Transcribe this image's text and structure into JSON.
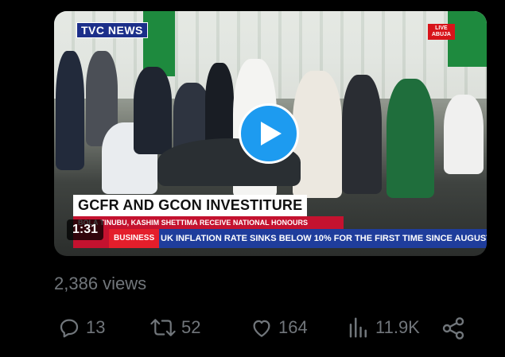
{
  "video": {
    "channel_logo": "TVC NEWS",
    "live_badge": [
      "LIVE",
      "ABUJA"
    ],
    "headline": "GCFR AND GCON INVESTITURE",
    "subheadline": "BOLA TINUBU, KASHIM SHETTIMA RECEIVE NATIONAL HONOURS",
    "ticker_tag": "BUSINESS",
    "ticker_text": "UK INFLATION RATE SINKS BELOW 10% FOR THE FIRST TIME SINCE AUGUST",
    "duration": "1:31",
    "play_icon": "play-icon"
  },
  "stats": {
    "views": "2,386 views"
  },
  "actions": {
    "replies": "13",
    "reposts": "52",
    "likes": "164",
    "views": "11.9K",
    "icons": [
      "reply-icon",
      "repost-icon",
      "like-icon",
      "analytics-icon",
      "share-icon"
    ]
  },
  "colors": {
    "accent": "#1d9bf0",
    "muted": "#71767b",
    "background": "#000000"
  }
}
